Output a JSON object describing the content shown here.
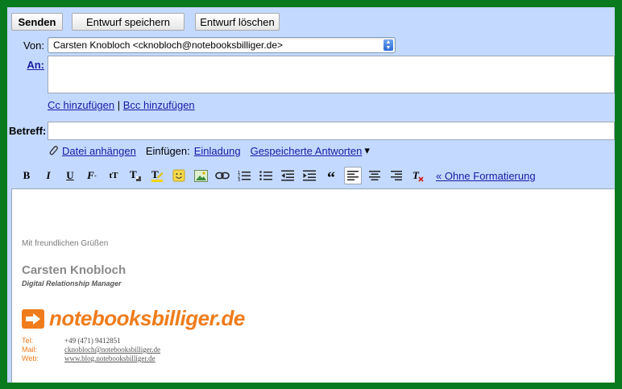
{
  "toolbar": {
    "send_label": "Senden",
    "save_draft_label": "Entwurf speichern",
    "delete_draft_label": "Entwurf löschen"
  },
  "from": {
    "label": "Von:",
    "value": "Carsten Knobloch <cknobloch@notebooksbilliger.de>"
  },
  "to": {
    "label": "An:"
  },
  "cc_bcc": {
    "cc_label": "Cc hinzufügen",
    "separator": "|",
    "bcc_label": "Bcc hinzufügen"
  },
  "subject": {
    "label": "Betreff:"
  },
  "attach": {
    "attach_label": "Datei anhängen",
    "insert_label": "Einfügen:",
    "invitation_label": "Einladung",
    "saved_replies_label": "Gespeicherte Antworten",
    "dropdown_glyph": "▾"
  },
  "formatting": {
    "icons": [
      "bold-icon",
      "italic-icon",
      "underline-icon",
      "font-icon",
      "font-size-icon",
      "text-color-icon",
      "highlight-icon",
      "emoticon-icon",
      "image-icon",
      "link-icon",
      "numbered-list-icon",
      "bullet-list-icon",
      "indent-less-icon",
      "indent-more-icon",
      "quote-icon",
      "align-left-icon",
      "align-center-icon",
      "align-right-icon",
      "remove-formatting-icon"
    ],
    "plain_text_label": "« Ohne Formatierung"
  },
  "signature": {
    "greeting": "Mit freundlichen Grüßen",
    "name": "Carsten Knobloch",
    "title": "Digital Relationship Manager",
    "logo_text": "notebooksbilliger.de",
    "tel_key": "Tel:",
    "tel_value": "+49 (471) 9412851",
    "mail_key": "Mail:",
    "mail_value": "cknobloch@notebooksbilliger.de",
    "web_key": "Web:",
    "web_value": "www.blog.notebooksbilliger.de"
  },
  "colors": {
    "frame": "#0a7a1e",
    "panel": "#c3d9ff",
    "link": "#1a1aa6",
    "brand": "#f07c1b"
  }
}
